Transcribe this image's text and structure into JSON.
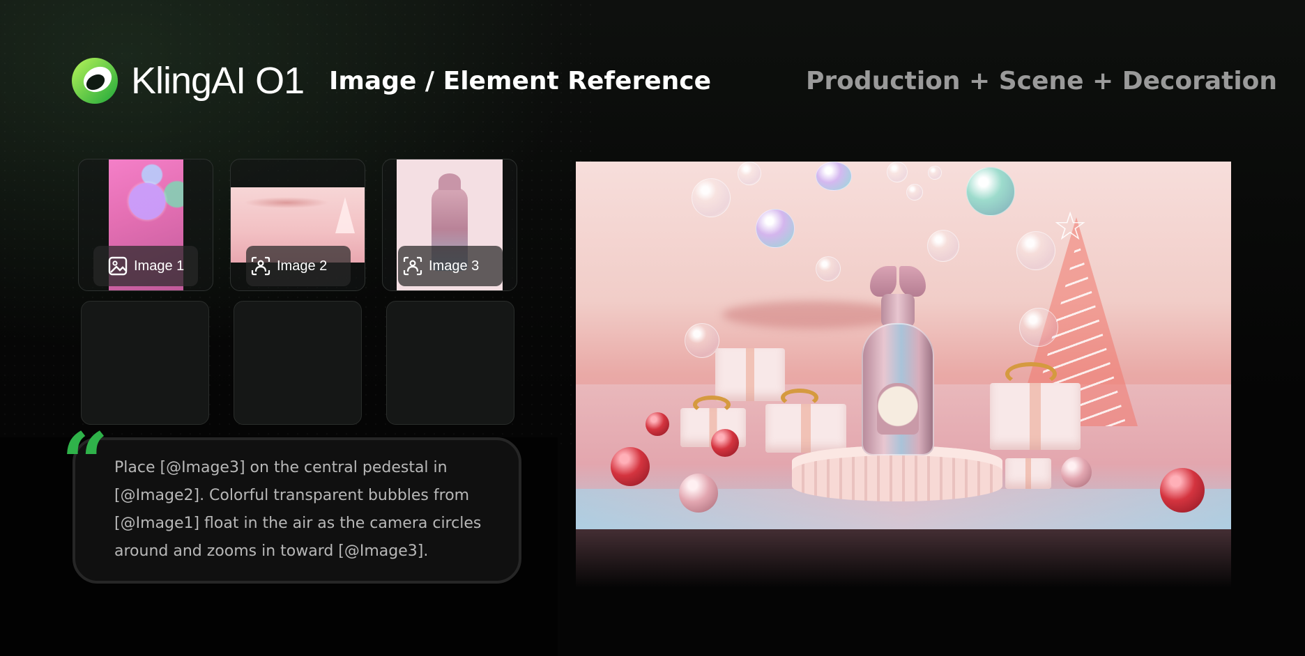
{
  "header": {
    "logo_text": "KlingAI O1",
    "title": "Image / Element Reference",
    "subtitle": "Production + Scene +  Decoration"
  },
  "reference_slots": [
    {
      "label": "Image 1",
      "icon": "image-icon",
      "filled": true
    },
    {
      "label": "Image 2",
      "icon": "element-icon",
      "filled": true
    },
    {
      "label": "Image 3",
      "icon": "element-icon",
      "filled": true
    },
    {
      "filled": false
    },
    {
      "filled": false
    },
    {
      "filled": false
    }
  ],
  "prompt": {
    "text": "Place [@Image3] on the central pedestal in [@Image2]. Colorful transparent bubbles from [@Image1] float in the air as the camera circles around and zooms in toward [@Image3]."
  },
  "colors": {
    "accent": "#2fb24a",
    "background": "#050505",
    "subtitle": "#9a9a9a"
  }
}
